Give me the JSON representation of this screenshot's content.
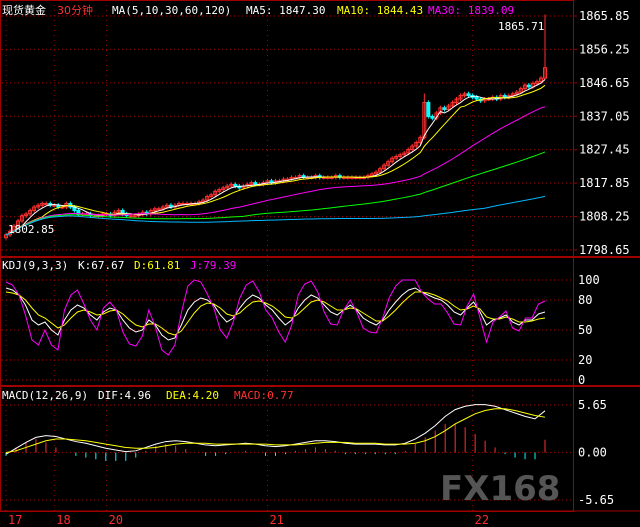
{
  "header": {
    "instrument": "现货黄金",
    "period": "30分钟",
    "ma_settings": "MA(5,10,30,60,120)",
    "ma5": "MA5: 1847.30",
    "ma10": "MA10: 1844.43",
    "ma30": "MA30: 1839.09"
  },
  "kdj_header": {
    "settings": "KDJ(9,3,3)",
    "k": "K:67.67",
    "d": "D:61.81",
    "j": "J:79.39"
  },
  "macd_header": {
    "settings": "MACD(12,26,9)",
    "dif": "DIF:4.96",
    "dea": "DEA:4.20",
    "macd": "MACD:0.77"
  },
  "annotations": {
    "high": "1865.71",
    "low": "1802.85"
  },
  "watermark": "FX168",
  "colors": {
    "background": "#000000",
    "grid": "#a00000",
    "up": "#ff3030",
    "down": "#00ffff",
    "ma5": "#ffffff",
    "ma10": "#ffff00",
    "ma30": "#ff00ff",
    "ma60": "#00ff00",
    "ma120": "#00b8ff",
    "k": "#ffffff",
    "d": "#ffff00",
    "j": "#ff00ff",
    "dif": "#ffffff",
    "dea": "#ffff00"
  },
  "chart_data": [
    {
      "type": "candlestick",
      "yticks": [
        1865.85,
        1856.25,
        1846.65,
        1837.05,
        1827.45,
        1817.85,
        1808.25,
        1798.65
      ],
      "ylim": [
        1798.65,
        1865.85
      ],
      "date_labels": [
        "17",
        "18",
        "20",
        "21",
        "22"
      ],
      "date_index": [
        0,
        12,
        25,
        65,
        116
      ],
      "close": [
        1803.0,
        1804.0,
        1805.5,
        1807.0,
        1808.5,
        1809.0,
        1810.0,
        1811.0,
        1811.5,
        1812.0,
        1812.0,
        1811.5,
        1811.5,
        1811.0,
        1811.0,
        1812.0,
        1811.0,
        1810.0,
        1809.0,
        1809.0,
        1809.0,
        1808.5,
        1808.5,
        1808.5,
        1809.0,
        1809.0,
        1808.5,
        1809.5,
        1810.0,
        1809.0,
        1808.5,
        1808.5,
        1808.5,
        1809.0,
        1809.5,
        1809.0,
        1810.0,
        1810.5,
        1810.5,
        1811.0,
        1811.5,
        1811.0,
        1811.5,
        1812.0,
        1812.0,
        1812.0,
        1812.0,
        1812.0,
        1812.5,
        1813.0,
        1814.0,
        1814.5,
        1815.5,
        1816.0,
        1816.5,
        1817.0,
        1817.5,
        1817.0,
        1816.5,
        1817.0,
        1817.5,
        1818.0,
        1817.5,
        1817.5,
        1818.0,
        1818.5,
        1818.0,
        1818.5,
        1818.5,
        1819.0,
        1819.0,
        1819.5,
        1819.5,
        1820.0,
        1819.5,
        1819.5,
        1819.5,
        1820.0,
        1819.5,
        1819.5,
        1819.5,
        1819.5,
        1820.0,
        1819.5,
        1819.5,
        1819.5,
        1819.5,
        1819.5,
        1819.5,
        1819.5,
        1820.0,
        1820.5,
        1821.0,
        1822.0,
        1823.0,
        1824.0,
        1825.0,
        1825.5,
        1826.0,
        1826.5,
        1827.5,
        1828.5,
        1829.5,
        1831.0,
        1841.0,
        1837.0,
        1836.5,
        1838.0,
        1839.5,
        1839.0,
        1840.0,
        1841.0,
        1842.0,
        1843.0,
        1843.5,
        1843.0,
        1842.5,
        1842.0,
        1841.5,
        1842.0,
        1842.0,
        1842.5,
        1842.0,
        1843.0,
        1842.5,
        1843.0,
        1843.5,
        1844.0,
        1845.0,
        1846.0,
        1845.5,
        1846.5,
        1847.0,
        1848.0,
        1851.0
      ],
      "ma": {
        "MA5": 1847.3,
        "MA10": 1844.43,
        "MA30": 1839.09
      }
    },
    {
      "type": "line",
      "indicator": "KDJ(9,3,3)",
      "yticks": [
        100,
        80,
        50,
        20,
        0
      ],
      "ylim": [
        0,
        100
      ],
      "series": [
        {
          "name": "K",
          "values": [
            92,
            90,
            85,
            75,
            60,
            55,
            58,
            50,
            45,
            60,
            70,
            75,
            72,
            65,
            60,
            68,
            72,
            70,
            60,
            52,
            48,
            50,
            60,
            55,
            45,
            40,
            42,
            55,
            70,
            78,
            82,
            80,
            75,
            65,
            58,
            62,
            72,
            80,
            85,
            82,
            75,
            70,
            62,
            55,
            60,
            72,
            80,
            85,
            82,
            75,
            68,
            65,
            70,
            75,
            70,
            62,
            58,
            55,
            60,
            70,
            78,
            85,
            90,
            92,
            88,
            85,
            82,
            80,
            75,
            68,
            65,
            72,
            78,
            68,
            55,
            60,
            62,
            65,
            58,
            55,
            60,
            60,
            66,
            68
          ]
        },
        {
          "name": "D",
          "values": [
            88,
            87,
            85,
            80,
            72,
            65,
            62,
            57,
            52,
            55,
            62,
            68,
            70,
            68,
            65,
            66,
            69,
            70,
            66,
            60,
            55,
            53,
            56,
            56,
            52,
            47,
            45,
            49,
            58,
            67,
            74,
            77,
            76,
            72,
            66,
            64,
            67,
            73,
            78,
            79,
            77,
            74,
            69,
            63,
            62,
            66,
            72,
            78,
            80,
            78,
            74,
            70,
            70,
            72,
            71,
            67,
            63,
            59,
            59,
            64,
            70,
            77,
            83,
            88,
            88,
            87,
            85,
            82,
            79,
            74,
            70,
            71,
            74,
            71,
            63,
            61,
            61,
            63,
            61,
            58,
            58,
            59,
            61,
            62
          ]
        },
        {
          "name": "J",
          "values": [
            98,
            95,
            85,
            65,
            40,
            35,
            50,
            35,
            30,
            70,
            85,
            90,
            76,
            60,
            50,
            72,
            78,
            70,
            48,
            36,
            34,
            44,
            70,
            53,
            30,
            25,
            35,
            67,
            94,
            100,
            98,
            86,
            72,
            50,
            42,
            58,
            82,
            95,
            99,
            88,
            70,
            62,
            48,
            38,
            55,
            85,
            96,
            99,
            88,
            68,
            56,
            55,
            70,
            80,
            68,
            52,
            48,
            47,
            62,
            82,
            94,
            100,
            100,
            100,
            88,
            81,
            76,
            76,
            67,
            56,
            55,
            74,
            86,
            62,
            38,
            58,
            63,
            69,
            52,
            49,
            62,
            62,
            76,
            79
          ]
        }
      ]
    },
    {
      "type": "bar+line",
      "indicator": "MACD(12,26,9)",
      "yticks": [
        5.65,
        0.0,
        -5.65
      ],
      "ylim": [
        -5.65,
        5.65
      ],
      "series": [
        {
          "name": "DIF",
          "values": [
            -0.2,
            0.5,
            1.2,
            1.8,
            2.0,
            1.9,
            1.6,
            1.3,
            1.1,
            0.8,
            0.5,
            0.3,
            0.1,
            0.2,
            0.6,
            1.0,
            1.3,
            1.4,
            1.3,
            1.1,
            0.9,
            0.8,
            0.9,
            1.0,
            1.1,
            1.0,
            0.8,
            0.7,
            0.8,
            1.0,
            1.2,
            1.4,
            1.4,
            1.3,
            1.1,
            1.0,
            1.0,
            1.0,
            0.9,
            0.9,
            1.1,
            1.6,
            2.3,
            3.2,
            4.3,
            5.1,
            5.5,
            5.7,
            5.7,
            5.5,
            5.1,
            4.7,
            4.3,
            4.0,
            4.96
          ]
        },
        {
          "name": "DEA",
          "values": [
            0.0,
            0.2,
            0.6,
            1.0,
            1.4,
            1.6,
            1.6,
            1.5,
            1.4,
            1.2,
            1.0,
            0.8,
            0.6,
            0.5,
            0.5,
            0.6,
            0.8,
            1.0,
            1.1,
            1.1,
            1.1,
            1.0,
            1.0,
            1.0,
            1.0,
            1.0,
            1.0,
            0.9,
            0.9,
            0.9,
            1.0,
            1.1,
            1.2,
            1.2,
            1.2,
            1.1,
            1.1,
            1.1,
            1.0,
            1.0,
            1.0,
            1.1,
            1.4,
            1.9,
            2.6,
            3.4,
            4.0,
            4.6,
            5.0,
            5.2,
            5.2,
            5.0,
            4.7,
            4.4,
            4.2
          ]
        }
      ]
    }
  ]
}
